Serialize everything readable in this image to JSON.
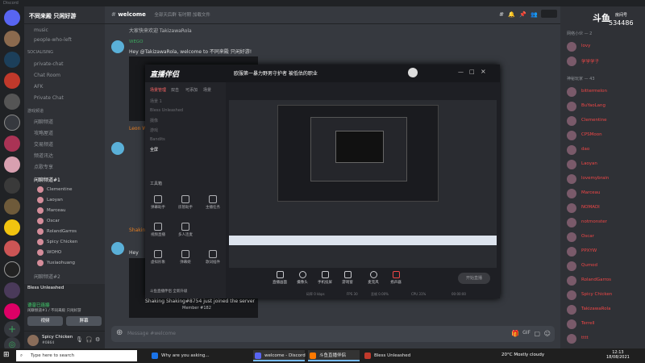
{
  "window": {
    "app_name": "Discord"
  },
  "server": {
    "name": "不同来殿 只闲好游"
  },
  "channel_header": {
    "name": "welcome",
    "topic": "全部天后群 有时期 加载文件"
  },
  "sidebar": {
    "items": [
      {
        "label": "music"
      },
      {
        "label": "people-who-left"
      },
      {
        "label": "SOCIALISING"
      },
      {
        "label": "private-chat"
      },
      {
        "label": "Chat Room"
      },
      {
        "label": "AFK"
      },
      {
        "label": "Private Chat"
      },
      {
        "label": "游戏频道"
      },
      {
        "label": "闲聊频道"
      },
      {
        "label": "攻略屋道"
      },
      {
        "label": "交易频道"
      },
      {
        "label": "频道讯达"
      },
      {
        "label": "点歌专享"
      },
      {
        "label": "闲聊频道#1"
      },
      {
        "label": "闲聊频道#2"
      }
    ],
    "voice_users": [
      "Clementine",
      "Laoyan",
      "Marceau",
      "Oscar",
      "RolandGarros",
      "Spicy Chicken",
      "WOHO",
      "Yuxiaohuang"
    ]
  },
  "voice_panel": {
    "status": "语音已连接",
    "channel": "闲聊频道#1 / 不同来殿 只闲好游",
    "video_label": "视频",
    "screen_label": "屏幕"
  },
  "streaming_notice": "Bless Unleashed",
  "user": {
    "name": "Spicy Chicken",
    "tag": "#0864"
  },
  "messages": {
    "m1_text": "大家快来欢迎 TakizawaRola",
    "m2_author": "WEGO",
    "m2_text": "Hey @TakizawaRola, welcome to 不同来殿 只闲好游!",
    "m3_author": "Leon W",
    "m4_author": "Shaking",
    "m5_text": "Hey",
    "join_text": "Shaking Shaking#8754 just joined the server",
    "member_no": "Member #182"
  },
  "composer": {
    "placeholder": "Message #welcome"
  },
  "members": {
    "cat1": "网络小伙 — 2",
    "cat2": "神秘玩家 — 43",
    "list": [
      {
        "name": "lovy"
      },
      {
        "name": "学学学子"
      },
      {
        "name": "bittermelon"
      },
      {
        "name": "BuYaoLang"
      },
      {
        "name": "Clementine"
      },
      {
        "name": "CPSMoon"
      },
      {
        "name": "dao"
      },
      {
        "name": "Laoyan"
      },
      {
        "name": "lovemybrain"
      },
      {
        "name": "Marceau"
      },
      {
        "name": "NOMADI"
      },
      {
        "name": "notmonster"
      },
      {
        "name": "Oscar"
      },
      {
        "name": "PPXYW"
      },
      {
        "name": "Qumod"
      },
      {
        "name": "RolandGarros"
      },
      {
        "name": "Spicy Chicken"
      },
      {
        "name": "TakizawaRola"
      },
      {
        "name": "Terrell"
      },
      {
        "name": "tttt"
      }
    ]
  },
  "douyu": {
    "logo": "斗鱼",
    "room_label": "房间号",
    "room_number": "534486"
  },
  "live_app": {
    "title": "直播伴侣",
    "stream_title": "欧服第一暴力野男守护者 被低估的职业",
    "tabs": [
      "场景管理",
      "双击",
      "可添加",
      "场景"
    ],
    "scenes": [
      "场景 1",
      "Bless Unleashed",
      "摄像",
      "游戏",
      "Bandits"
    ],
    "active_scene": "全屏",
    "tools_label": "工具箱",
    "tools": [
      "弹幕助手",
      "房管助手",
      "主播任务",
      "视频直播",
      "多人连麦",
      "虚拟形象",
      "弹幕姬",
      "歌词插件"
    ],
    "controls": [
      "直播画面",
      "摄像头",
      "手机投屏",
      "游戏窗",
      "麦克风",
      "扬声器"
    ],
    "start_label": "开始直播",
    "stats": [
      "码率 0 kbps",
      "FPS 30",
      "丢帧 0.00%",
      "CPU 31%",
      "00:00:00"
    ],
    "notice": "斗鱼直播伴侣 全新升级"
  },
  "taskbar": {
    "search": "Type here to search",
    "items": [
      "Why are you asking...",
      "welcome - Discord",
      "斗鱼直播伴侣",
      "Bless Unleashed"
    ],
    "weather": "20°C  Mostly cloudy",
    "time": "12:13",
    "date": "18/08/2021"
  },
  "colors": {
    "blurple": "#5865f2",
    "green": "#3ba55d",
    "brand_red": "#f04747"
  }
}
